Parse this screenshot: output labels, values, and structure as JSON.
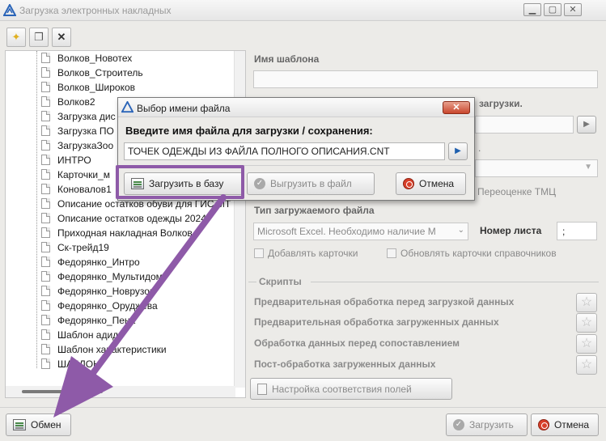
{
  "window": {
    "title": "Загрузка электронных накладных"
  },
  "tree": {
    "items": [
      "Волков_Новотех",
      "Волков_Строитель",
      "Волков_Широков",
      "Волков2",
      "Загрузка дис",
      "Загрузка ПО",
      "ЗагрузкаЗоо",
      "ИНТРО",
      "Карточки_м",
      "Коновалов1",
      "Описание остатков обуви для ГИС МТ",
      "Описание остатков одежды 2024",
      "Приходная накладная Волков",
      "Ск-трейд19",
      "Федорянко_Интро",
      "Федорянко_Мультидом",
      "Федорянко_Новрузов",
      "Федорянко_Оруджева",
      "Федорянко_Пена",
      "Шаблон адид",
      "Шаблон характеристики",
      "ШАБЛОН"
    ]
  },
  "right_panel": {
    "template_name_label": "Имя шаблона",
    "load_label_fragment": "загрузки.",
    "revaluation_fragment": "Переоценке ТМЦ",
    "file_type_label": "Тип загружаемого файла",
    "file_type_value": "Microsoft Excel. Необходимо наличие M",
    "sheet_number_label": "Номер листа",
    "sheet_number_value": ";",
    "add_cards_label": "Добавлять карточки",
    "update_cards_label": "Обновлять карточки справочников",
    "scripts_label": "Скрипты",
    "scripts": [
      "Предварительная обработка  перед загрузкой данных",
      "Предварительная обработка загруженных данных",
      "Обработка данных перед сопоставлением",
      "Пост-обработка загруженных данных"
    ],
    "field_mapping_button": "Настройка соответствия полей"
  },
  "dialog": {
    "title": "Выбор имени файла",
    "prompt": "Введите имя файла для загрузки / сохранения:",
    "filename_value": "ТОЧЕК ОДЕЖДЫ ИЗ ФАЙЛА ПОЛНОГО ОПИСАНИЯ.CNT",
    "load_to_db_button": "Загрузить в базу",
    "export_to_file_button": "Выгрузить в файл",
    "cancel_button": "Отмена"
  },
  "bottom_bar": {
    "exchange_button": "Обмен",
    "load_button": "Загрузить",
    "cancel_button": "Отмена"
  },
  "colors": {
    "annotation": "#8e5aa8",
    "window_bg": "#ecebe8",
    "cancel_icon": "#d8402a"
  }
}
